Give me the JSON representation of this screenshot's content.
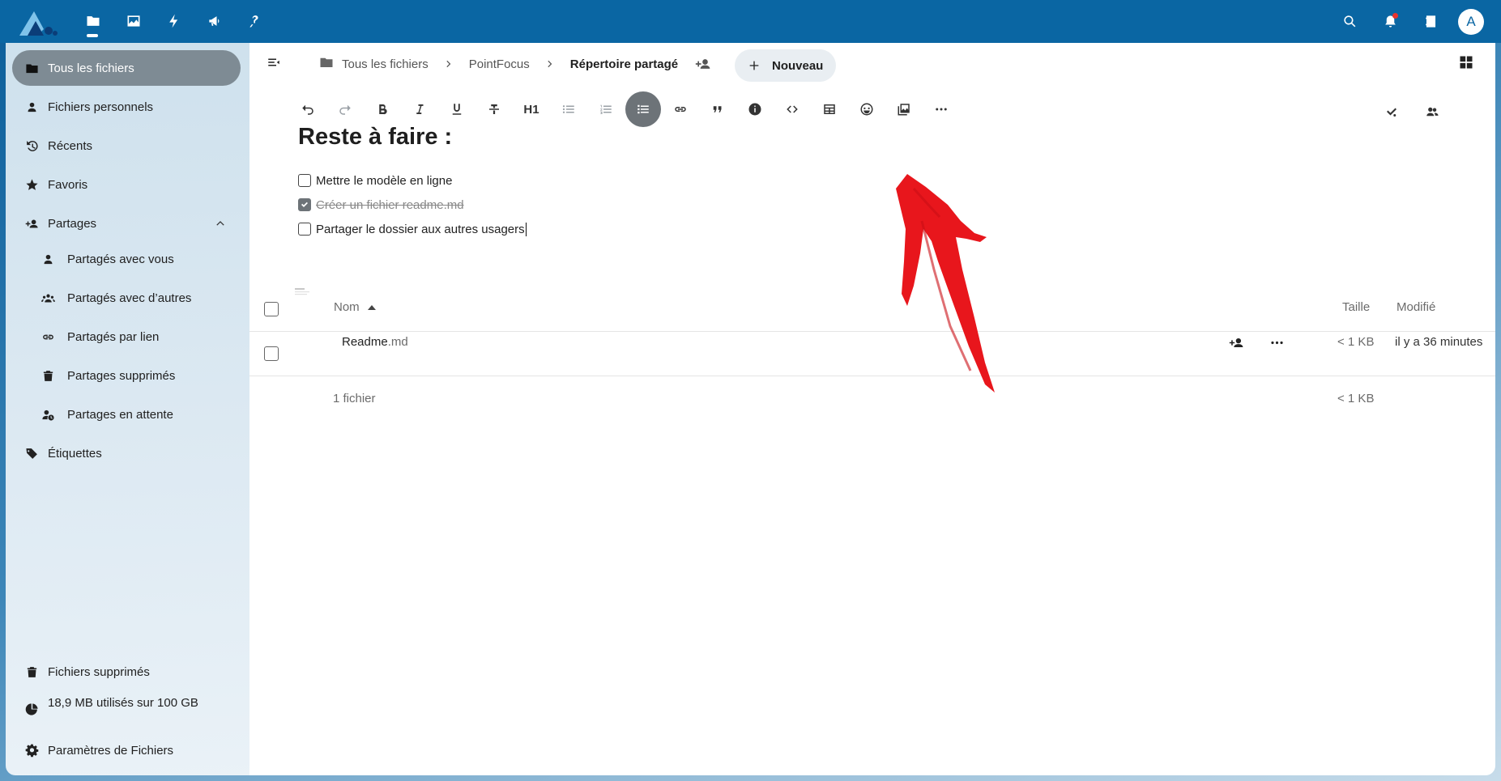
{
  "header": {
    "apps": [
      "files-icon",
      "photos-icon",
      "activity-icon",
      "announcements-icon",
      "help-icon"
    ],
    "avatar_initial": "A"
  },
  "sidebar": {
    "items": [
      {
        "label": "Tous les fichiers",
        "icon": "folder-icon"
      },
      {
        "label": "Fichiers personnels",
        "icon": "user-icon"
      },
      {
        "label": "Récents",
        "icon": "history-icon"
      },
      {
        "label": "Favoris",
        "icon": "star-icon"
      },
      {
        "label": "Partages",
        "icon": "share-icon"
      },
      {
        "label": "Partagés avec vous",
        "icon": "user-icon"
      },
      {
        "label": "Partagés avec d’autres",
        "icon": "users-icon"
      },
      {
        "label": "Partagés par lien",
        "icon": "link-icon"
      },
      {
        "label": "Partages supprimés",
        "icon": "trash-icon"
      },
      {
        "label": "Partages en attente",
        "icon": "user-clock-icon"
      },
      {
        "label": "Étiquettes",
        "icon": "tag-icon"
      }
    ],
    "footer": {
      "trash": "Fichiers supprimés",
      "quota": "18,9 MB utilisés sur 100 GB",
      "settings": "Paramètres de Fichiers"
    }
  },
  "breadcrumb": {
    "items": [
      "Tous les fichiers",
      "PointFocus",
      "Répertoire partagé"
    ]
  },
  "new_button": "Nouveau",
  "editor": {
    "toolbar": {
      "heading": "H1"
    },
    "title": "Reste à faire :",
    "tasks": [
      {
        "text": "Mettre le modèle en ligne",
        "done": false
      },
      {
        "text": "Créer un fichier readme.md",
        "done": true
      },
      {
        "text": "Partager le dossier aux autres usagers",
        "done": false
      }
    ]
  },
  "file_list": {
    "columns": {
      "name": "Nom",
      "size": "Taille",
      "modified": "Modifié"
    },
    "rows": [
      {
        "name": "Readme",
        "ext": ".md",
        "size": "< 1 KB",
        "modified": "il y a 36 minutes"
      }
    ],
    "summary": {
      "count": "1 fichier",
      "size": "< 1 KB"
    }
  },
  "colors": {
    "header_bg": "#0a66a3",
    "active_nav": "#7e8b94",
    "annotation_arrow": "#e8161c"
  }
}
